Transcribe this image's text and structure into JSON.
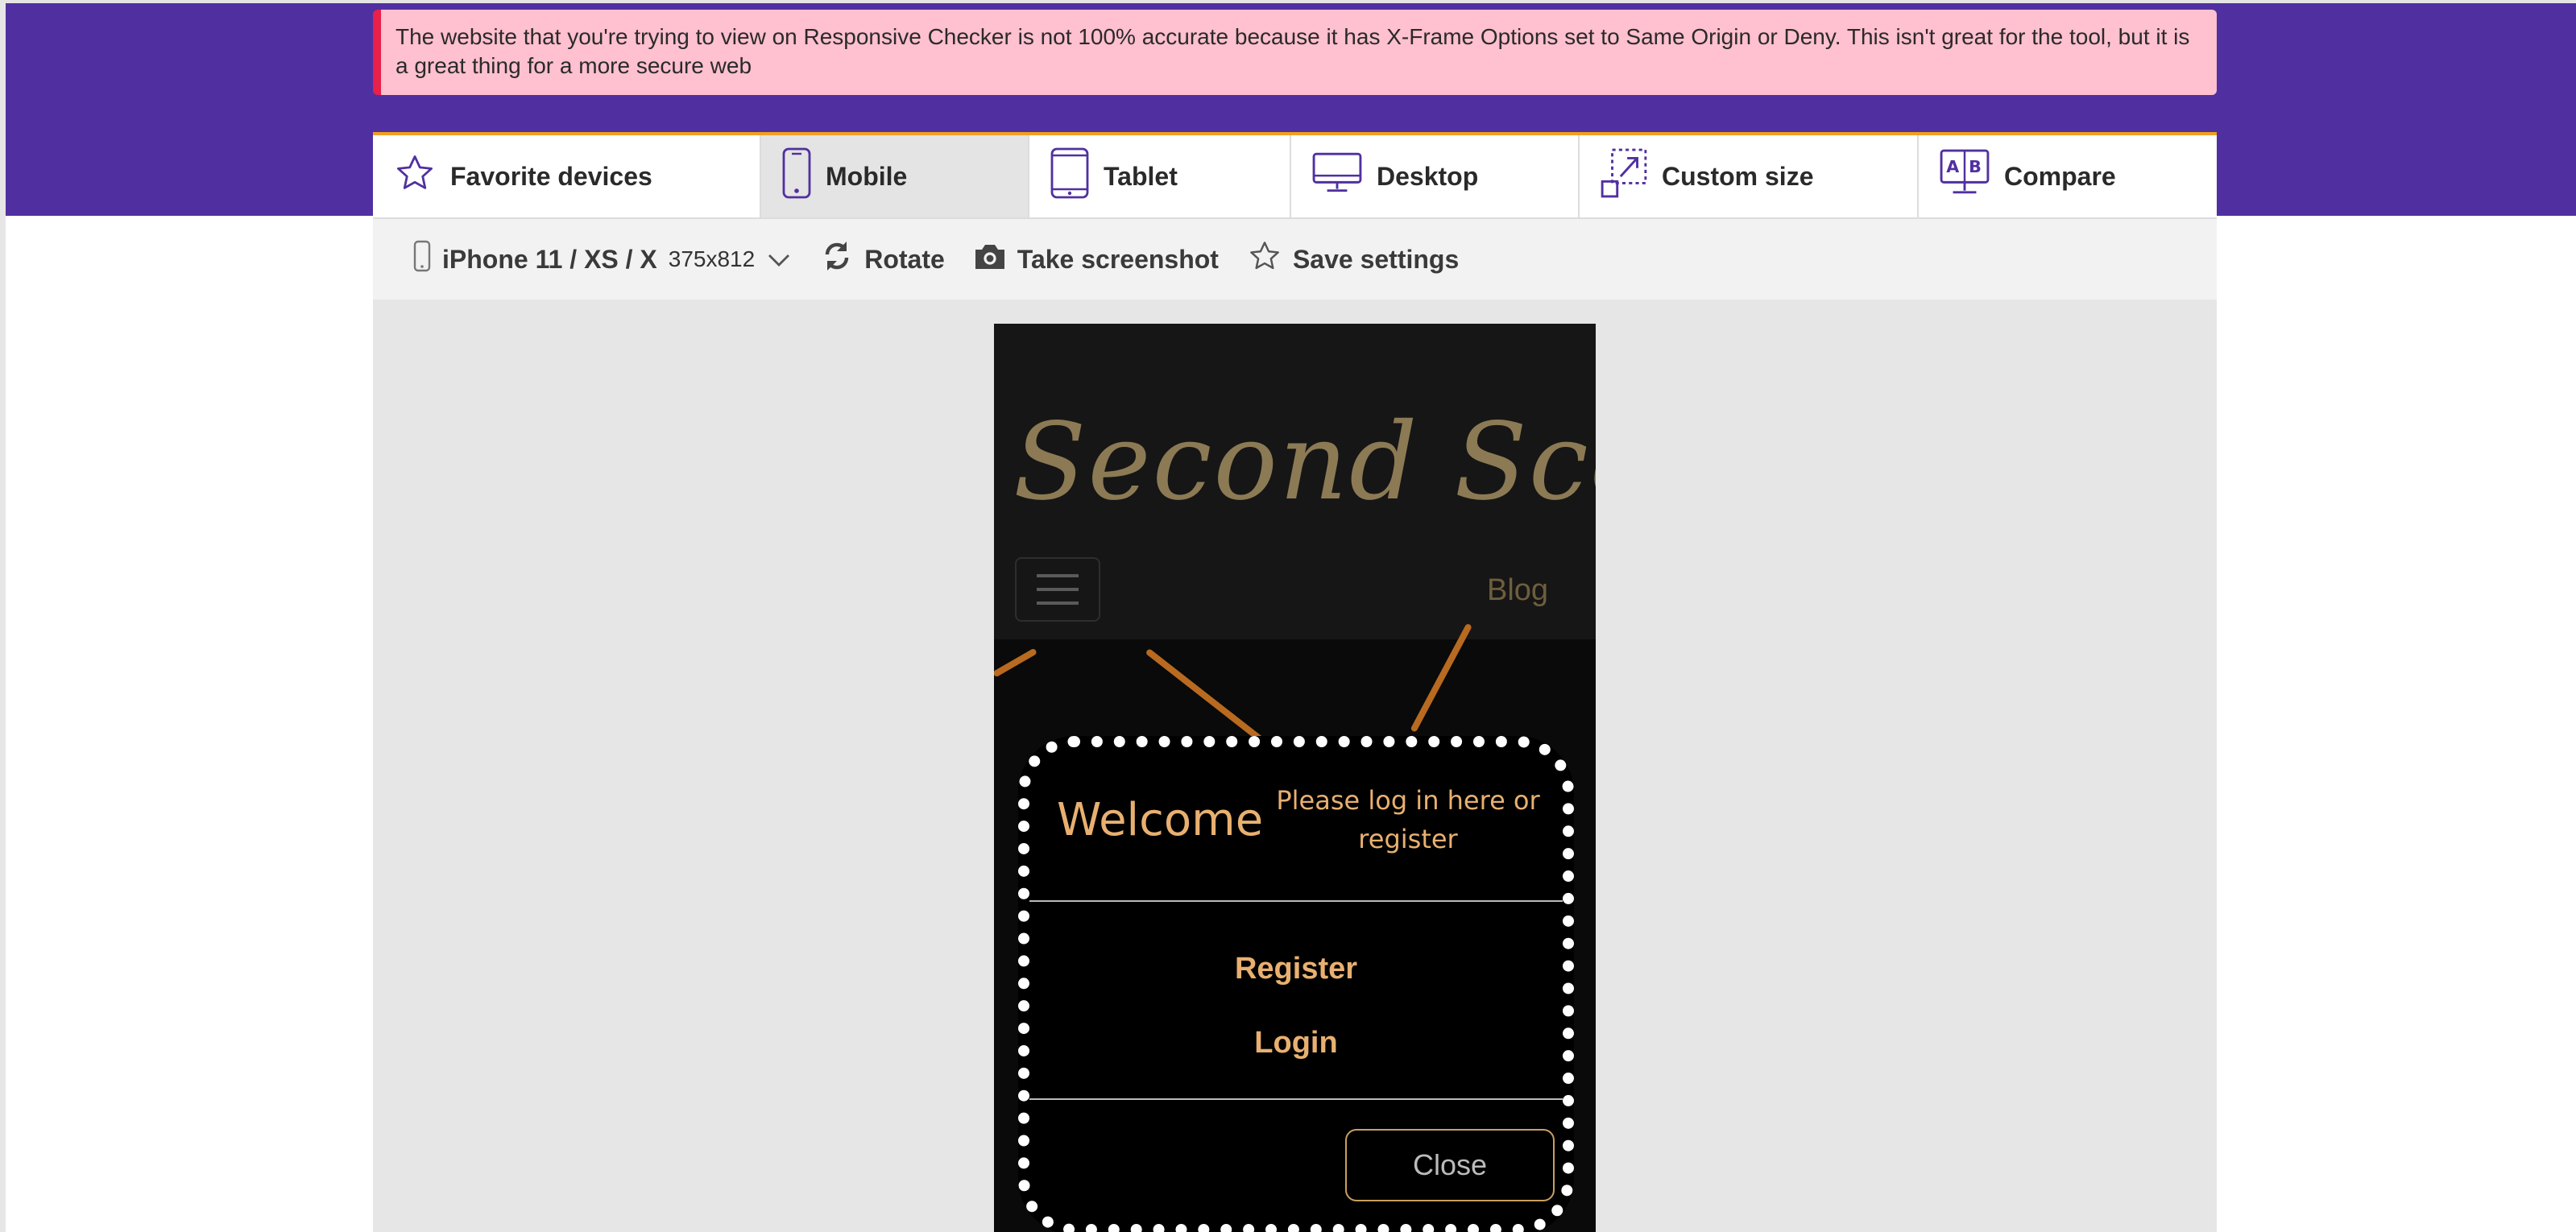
{
  "alert": {
    "text": "The website that you're trying to view on Responsive Checker is not 100% accurate because it has X-Frame Options set to Same Origin or Deny. This isn't great for the tool, but it is a great thing for a more secure web"
  },
  "tabs": [
    {
      "label": "Favorite devices",
      "icon": "star-icon",
      "active": false
    },
    {
      "label": "Mobile",
      "icon": "mobile-icon",
      "active": true
    },
    {
      "label": "Tablet",
      "icon": "tablet-icon",
      "active": false
    },
    {
      "label": "Desktop",
      "icon": "desktop-icon",
      "active": false
    },
    {
      "label": "Custom size",
      "icon": "custom-size-icon",
      "active": false
    },
    {
      "label": "Compare",
      "icon": "compare-icon",
      "active": false
    }
  ],
  "toolbar": {
    "device_name": "iPhone 11 / XS / X",
    "device_dims": "375x812",
    "rotate_label": "Rotate",
    "screenshot_label": "Take screenshot",
    "save_label": "Save settings"
  },
  "site": {
    "logo_text": "Second Scoop",
    "blog_link": "Blog"
  },
  "modal": {
    "welcome": "Welcome",
    "hint": "Please log in here or register",
    "register": "Register",
    "login": "Login",
    "close": "Close"
  },
  "colors": {
    "brand_purple": "#5030a0",
    "alert_bg": "#ffc0d0",
    "alert_border": "#e8204a",
    "accent_gold": "#e8b070",
    "tab_top_border": "#f0a020"
  }
}
